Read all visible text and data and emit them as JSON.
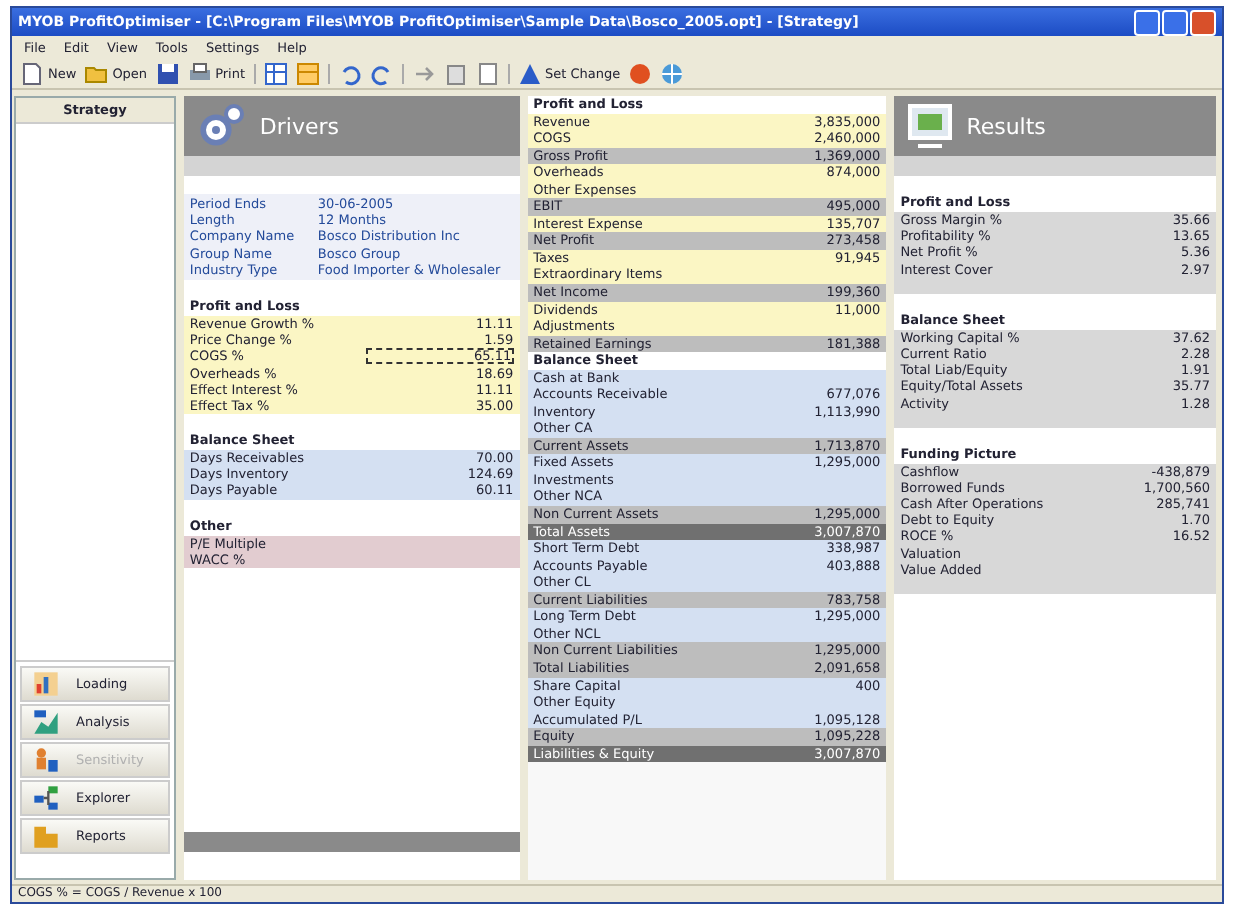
{
  "window": {
    "title": "MYOB ProfitOptimiser - [C:\\Program Files\\MYOB ProfitOptimiser\\Sample Data\\Bosco_2005.opt] - [Strategy]"
  },
  "menu": [
    "File",
    "Edit",
    "View",
    "Tools",
    "Settings",
    "Help"
  ],
  "toolbar": [
    {
      "kind": "labelled",
      "label": "New"
    },
    {
      "kind": "labelled",
      "label": "Open"
    },
    {
      "kind": "icon"
    },
    {
      "kind": "labelled",
      "label": "Print"
    },
    {
      "kind": "icon"
    },
    {
      "kind": "icon"
    },
    {
      "kind": "icon"
    },
    {
      "kind": "icon"
    },
    {
      "kind": "icon"
    },
    {
      "kind": "icon"
    },
    {
      "kind": "icon"
    },
    {
      "kind": "labelled",
      "label": "Set Change"
    },
    {
      "kind": "icon"
    },
    {
      "kind": "icon"
    }
  ],
  "sidebar": {
    "title": "Strategy",
    "nav": [
      {
        "label": "Loading",
        "disabled": false
      },
      {
        "label": "Analysis",
        "disabled": false
      },
      {
        "label": "Sensitivity",
        "disabled": true
      },
      {
        "label": "Explorer",
        "disabled": false
      },
      {
        "label": "Reports",
        "disabled": false
      }
    ]
  },
  "drivers": {
    "title": "Drivers",
    "info": [
      {
        "label": "Period Ends",
        "value": "30-06-2005"
      },
      {
        "label": "Length",
        "value": "12 Months"
      },
      {
        "label": "Company Name",
        "value": "Bosco Distribution Inc"
      },
      {
        "label": "Group Name",
        "value": "Bosco Group"
      },
      {
        "label": "Industry Type",
        "value": "Food Importer & Wholesaler"
      }
    ],
    "groups": [
      {
        "title": "Profit and Loss",
        "kind": "pl",
        "rows": [
          {
            "label": "Revenue Growth %",
            "value": "11.11",
            "selected": false
          },
          {
            "label": "Price Change %",
            "value": "1.59",
            "selected": false
          },
          {
            "label": "COGS %",
            "value": "65.11",
            "selected": true
          },
          {
            "label": "Overheads %",
            "value": "18.69",
            "selected": false
          },
          {
            "label": "Effect Interest %",
            "value": "11.11",
            "selected": false
          },
          {
            "label": "Effect Tax %",
            "value": "35.00",
            "selected": false
          }
        ]
      },
      {
        "title": "Balance Sheet",
        "kind": "bs",
        "rows": [
          {
            "label": "Days Receivables",
            "value": "70.00",
            "selected": false
          },
          {
            "label": "Days Inventory",
            "value": "124.69",
            "selected": false
          },
          {
            "label": "Days Payable",
            "value": "60.11",
            "selected": false
          }
        ]
      },
      {
        "title": "Other",
        "kind": "other",
        "rows": [
          {
            "label": "P/E Multiple",
            "value": "",
            "selected": false
          },
          {
            "label": "WACC %",
            "value": "",
            "selected": false
          }
        ]
      }
    ]
  },
  "statements": [
    {
      "title": "Profit and Loss",
      "kind": "pl",
      "rows": [
        {
          "label": "Revenue",
          "value": "3,835,000",
          "kind": "item"
        },
        {
          "label": "COGS",
          "value": "2,460,000",
          "kind": "item"
        },
        {
          "label": "Gross Profit",
          "value": "1,369,000",
          "kind": "subtotal"
        },
        {
          "label": "Overheads",
          "value": "874,000",
          "kind": "item"
        },
        {
          "label": "Other Expenses",
          "value": "",
          "kind": "item"
        },
        {
          "label": "EBIT",
          "value": "495,000",
          "kind": "subtotal"
        },
        {
          "label": "Interest Expense",
          "value": "135,707",
          "kind": "item"
        },
        {
          "label": "Net Profit",
          "value": "273,458",
          "kind": "subtotal"
        },
        {
          "label": "Taxes",
          "value": "91,945",
          "kind": "item"
        },
        {
          "label": "Extraordinary Items",
          "value": "",
          "kind": "item"
        },
        {
          "label": "Net Income",
          "value": "199,360",
          "kind": "subtotal"
        },
        {
          "label": "Dividends",
          "value": "11,000",
          "kind": "item"
        },
        {
          "label": "Adjustments",
          "value": "",
          "kind": "item"
        },
        {
          "label": "Retained Earnings",
          "value": "181,388",
          "kind": "subtotal"
        }
      ]
    },
    {
      "title": "Balance Sheet",
      "kind": "bs",
      "rows": [
        {
          "label": "Cash at Bank",
          "value": "",
          "kind": "item"
        },
        {
          "label": "Accounts Receivable",
          "value": "677,076",
          "kind": "item"
        },
        {
          "label": "Inventory",
          "value": "1,113,990",
          "kind": "item"
        },
        {
          "label": "Other CA",
          "value": "",
          "kind": "item"
        },
        {
          "label": "Current Assets",
          "value": "1,713,870",
          "kind": "subtotal"
        },
        {
          "label": "Fixed Assets",
          "value": "1,295,000",
          "kind": "item"
        },
        {
          "label": "Investments",
          "value": "",
          "kind": "item"
        },
        {
          "label": "Other NCA",
          "value": "",
          "kind": "item"
        },
        {
          "label": "Non Current Assets",
          "value": "1,295,000",
          "kind": "subtotal"
        },
        {
          "label": "Total Assets",
          "value": "3,007,870",
          "kind": "total"
        },
        {
          "label": "Short Term Debt",
          "value": "338,987",
          "kind": "item"
        },
        {
          "label": "Accounts Payable",
          "value": "403,888",
          "kind": "item"
        },
        {
          "label": "Other CL",
          "value": "",
          "kind": "item"
        },
        {
          "label": "Current Liabilities",
          "value": "783,758",
          "kind": "subtotal"
        },
        {
          "label": "Long Term Debt",
          "value": "1,295,000",
          "kind": "item"
        },
        {
          "label": "Other NCL",
          "value": "",
          "kind": "item"
        },
        {
          "label": "Non Current Liabilities",
          "value": "1,295,000",
          "kind": "subtotal"
        },
        {
          "label": "Total Liabilities",
          "value": "2,091,658",
          "kind": "subtotal"
        },
        {
          "label": "Share Capital",
          "value": "400",
          "kind": "item"
        },
        {
          "label": "Other Equity",
          "value": "",
          "kind": "item"
        },
        {
          "label": "Accumulated P/L",
          "value": "1,095,128",
          "kind": "item"
        },
        {
          "label": "Equity",
          "value": "1,095,228",
          "kind": "subtotal"
        },
        {
          "label": "Liabilities & Equity",
          "value": "3,007,870",
          "kind": "total"
        }
      ]
    }
  ],
  "results": {
    "title": "Results",
    "groups": [
      {
        "title": "Profit and Loss",
        "rows": [
          {
            "label": "Gross Margin %",
            "value": "35.66"
          },
          {
            "label": "Profitability %",
            "value": "13.65"
          },
          {
            "label": "Net Profit %",
            "value": "5.36"
          },
          {
            "label": "Interest Cover",
            "value": "2.97"
          }
        ]
      },
      {
        "title": "Balance Sheet",
        "rows": [
          {
            "label": "Working Capital %",
            "value": "37.62"
          },
          {
            "label": "Current Ratio",
            "value": "2.28"
          },
          {
            "label": "Total Liab/Equity",
            "value": "1.91"
          },
          {
            "label": "Equity/Total Assets",
            "value": "35.77"
          },
          {
            "label": "Activity",
            "value": "1.28"
          }
        ]
      },
      {
        "title": "Funding Picture",
        "rows": [
          {
            "label": "Cashflow",
            "value": "-438,879"
          },
          {
            "label": "Borrowed Funds",
            "value": "1,700,560"
          },
          {
            "label": "Cash After Operations",
            "value": "285,741"
          },
          {
            "label": "Debt to Equity",
            "value": "1.70"
          },
          {
            "label": "ROCE %",
            "value": "16.52"
          },
          {
            "label": "Valuation",
            "value": ""
          },
          {
            "label": "Value Added",
            "value": ""
          }
        ]
      }
    ]
  },
  "status_bar": "COGS % = COGS / Revenue x 100"
}
